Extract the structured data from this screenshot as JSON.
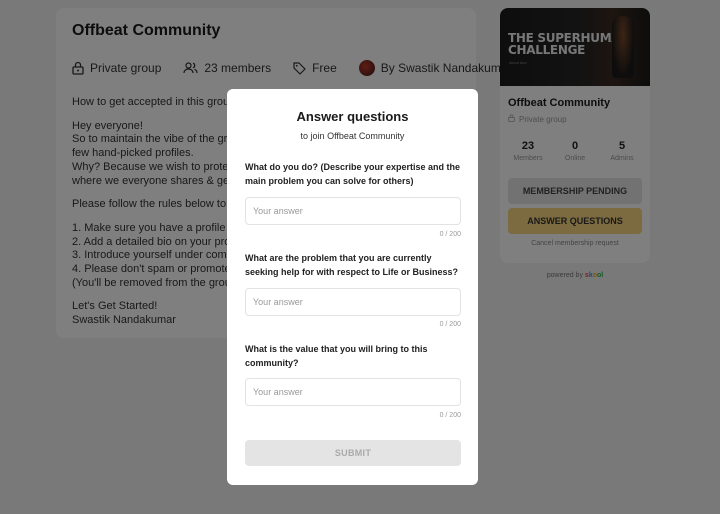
{
  "group": {
    "title": "Offbeat Community",
    "privacy_label": "Private group",
    "members_label": "23 members",
    "price_label": "Free",
    "owner_label": "By Swastik Nandakumar"
  },
  "about": {
    "lines": [
      "How to get accepted in this group??",
      "",
      "Hey everyone!",
      "So to maintain the vibe of the group, we",
      "few hand-picked profiles.",
      "Why? Because we wish to protect the c",
      "where we everyone shares & gets value",
      "",
      "Please follow the rules below to get acc",
      "",
      "1. Make sure you have a profile picture",
      "2. Add a detailed bio on your profile.",
      "3. Introduce yourself under community",
      "4. Please don't spam or promote here.",
      "(You'll be removed from the group othe",
      "",
      "Let's Get Started!",
      "Swastik Nandakumar"
    ]
  },
  "sidebar": {
    "cover_title_line1": "THE SUPERHUMAN",
    "cover_title_line2": "CHALLENGE",
    "cover_subtitle": "shoot tour",
    "title": "Offbeat Community",
    "subtitle": "Private group",
    "stats": [
      {
        "value": "23",
        "label": "Members"
      },
      {
        "value": "0",
        "label": "Online"
      },
      {
        "value": "5",
        "label": "Admins"
      }
    ],
    "pending_label": "MEMBERSHIP PENDING",
    "answer_label": "ANSWER QUESTIONS",
    "cancel_label": "Cancel membership request"
  },
  "powered": {
    "prefix": "powered by",
    "brand": [
      "s",
      "k",
      "o",
      "ol"
    ]
  },
  "modal": {
    "title": "Answer questions",
    "subtitle": "to join Offbeat Community",
    "questions": [
      {
        "text": "What do you do? (Describe your expertise and the main problem you can solve for others)",
        "placeholder": "Your answer",
        "value": "",
        "counter": "0 / 200"
      },
      {
        "text": "What are the problem that you are currently seeking help for with respect to Life or Business?",
        "placeholder": "Your answer",
        "value": "",
        "counter": "0 / 200"
      },
      {
        "text": "What is the value that you will bring to this community?",
        "placeholder": "Your answer",
        "value": "",
        "counter": "0 / 200"
      }
    ],
    "submit_label": "SUBMIT"
  },
  "colors": {
    "answer_button": "#f8d481",
    "pending_button": "#e4e4e4",
    "overlay": "rgba(0,0,0,0.5)"
  }
}
